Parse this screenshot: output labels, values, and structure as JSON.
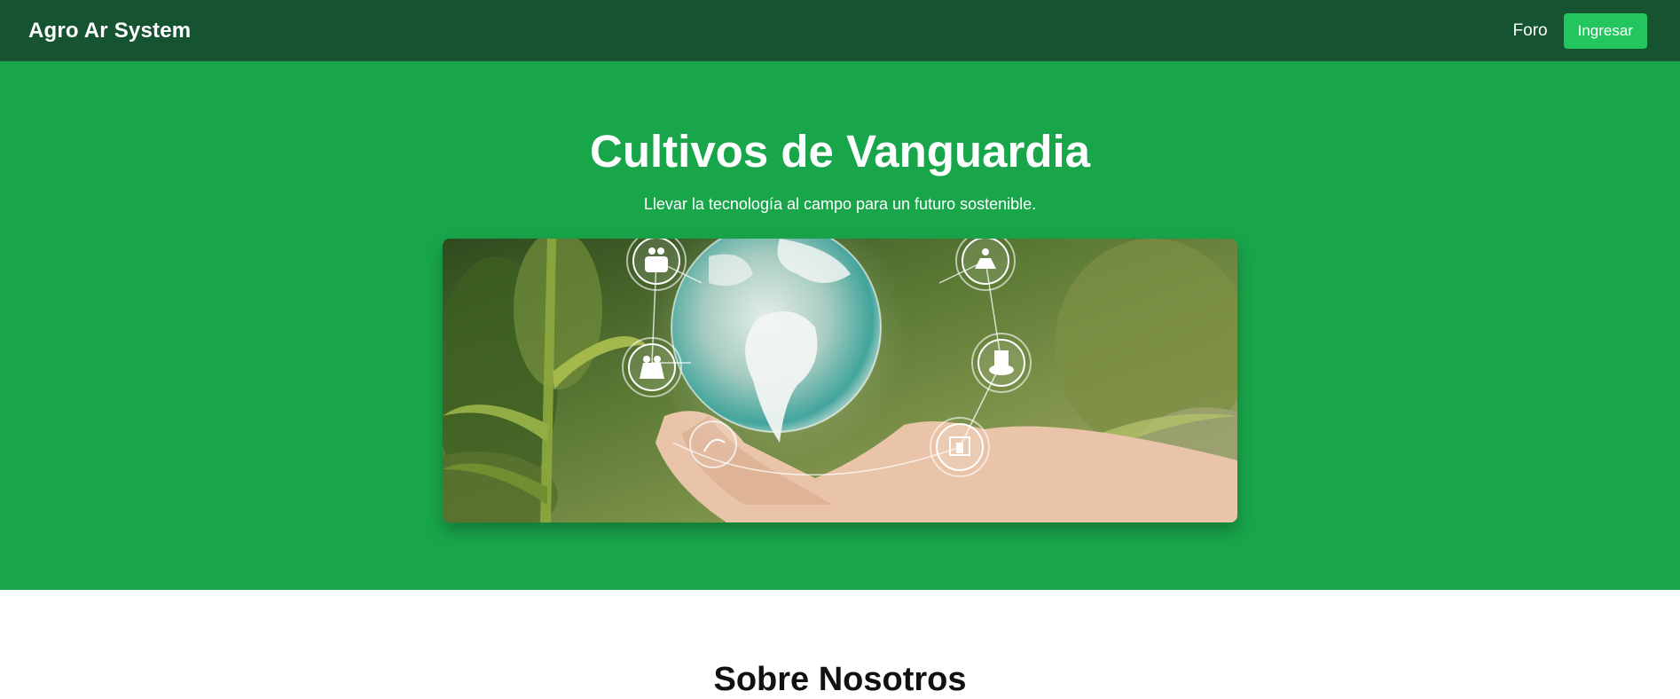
{
  "nav": {
    "brand": "Agro Ar System",
    "links": [
      {
        "label": "Foro"
      }
    ],
    "login_label": "Ingresar"
  },
  "hero": {
    "title": "Cultivos de Vanguardia",
    "subtitle": "Llevar la tecnología al campo para un futuro sostenible.",
    "image_icons": [
      "seed-bag-icon",
      "sprinkler-icon",
      "farmer-icon",
      "irrigation-icon",
      "building-icon"
    ]
  },
  "about": {
    "title": "Sobre Nosotros"
  },
  "colors": {
    "navbar": "#165331",
    "hero_bg": "#19a54a",
    "button": "#22c55e"
  }
}
